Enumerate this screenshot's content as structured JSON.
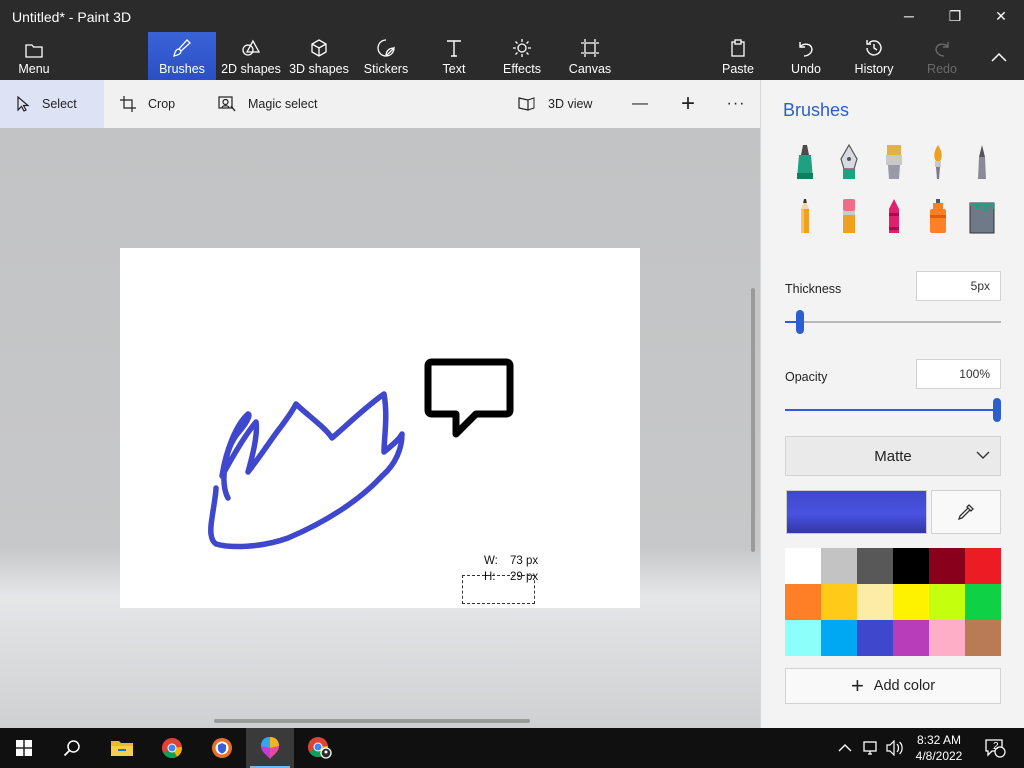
{
  "window": {
    "title": "Untitled* - Paint 3D",
    "controls": {
      "minimize": "─",
      "maximize": "❐",
      "close": "✕"
    }
  },
  "ribbon": {
    "menu": "Menu",
    "brushes": "Brushes",
    "shapes2d": "2D shapes",
    "shapes3d": "3D shapes",
    "stickers": "Stickers",
    "text": "Text",
    "effects": "Effects",
    "canvas": "Canvas",
    "paste": "Paste",
    "undo": "Undo",
    "history": "History",
    "redo": "Redo",
    "accent": "#3a63d8"
  },
  "toolbar": {
    "select": "Select",
    "crop": "Crop",
    "magic_select": "Magic select",
    "view3d": "3D view",
    "zoom_out": "—",
    "zoom_in": "+",
    "more": "···"
  },
  "canvas": {
    "selection": {
      "w_label": "W:",
      "w_value": "73 px",
      "h_label": "H:",
      "h_value": "29 px"
    },
    "stroke_color": "#3f47cc"
  },
  "panel": {
    "title": "Brushes",
    "brushes": [
      "marker-icon",
      "calligraphy-pen-icon",
      "oil-brush-icon",
      "watercolor-icon",
      "pixel-pen-icon",
      "pencil-icon",
      "eraser-icon",
      "crayon-icon",
      "spray-can-icon",
      "fill-bucket-icon"
    ],
    "thickness_label": "Thickness",
    "thickness_value": "5px",
    "thickness_level": 0.05,
    "opacity_label": "Opacity",
    "opacity_value": "100%",
    "opacity_level": 1.0,
    "finish": "Matte",
    "current_color": "#3f47cc",
    "palette": [
      "#ffffff",
      "#c3c3c3",
      "#585858",
      "#000000",
      "#88001b",
      "#ec1c24",
      "#ff7f27",
      "#ffca18",
      "#fdeca6",
      "#fff200",
      "#c4ff0e",
      "#0ed145",
      "#8cfffb",
      "#00a8f3",
      "#3f48cc",
      "#b83dba",
      "#ffaec8",
      "#b97a56"
    ],
    "add_color": "Add color"
  },
  "taskbar": {
    "time": "8:32 AM",
    "date": "4/8/2022",
    "notifications": "2"
  }
}
